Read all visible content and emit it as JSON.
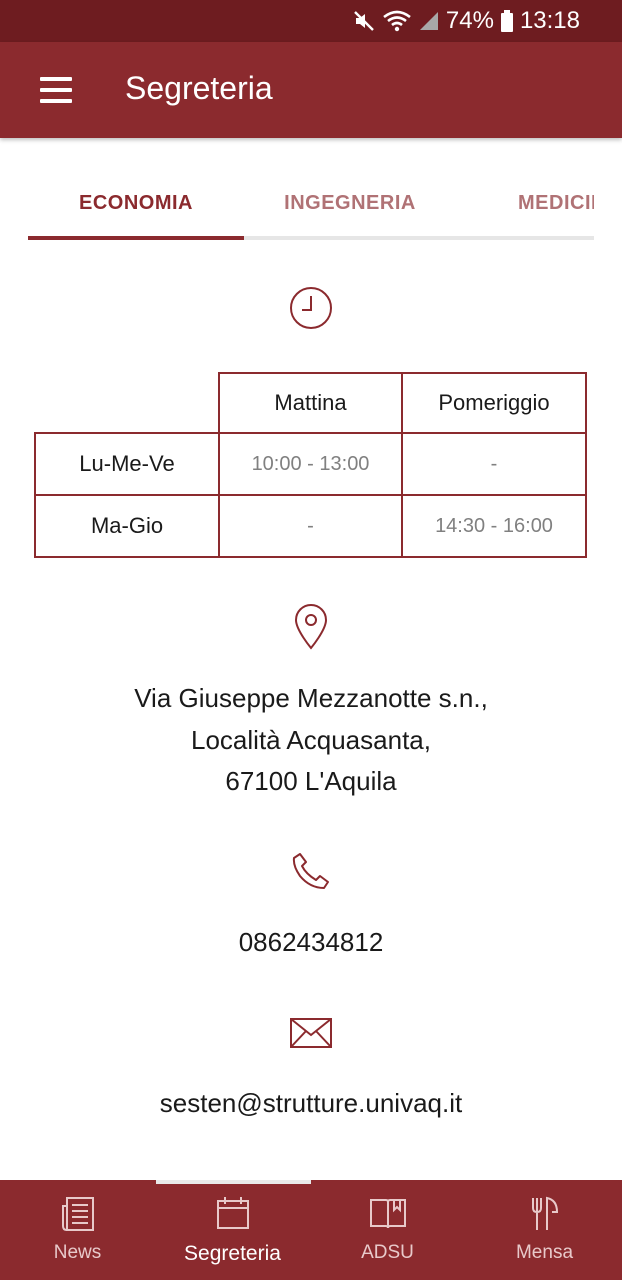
{
  "status_bar": {
    "battery": "74%",
    "time": "13:18"
  },
  "app_bar": {
    "title": "Segreteria"
  },
  "tabs": [
    {
      "label": "ECONOMIA",
      "active": true
    },
    {
      "label": "INGEGNERIA",
      "active": false
    },
    {
      "label": "MEDICIN",
      "active": false
    }
  ],
  "schedule": {
    "columns": [
      "Mattina",
      "Pomeriggio"
    ],
    "rows": [
      {
        "day": "Lu-Me-Ve",
        "morning": "10:00 - 13:00",
        "afternoon": "-"
      },
      {
        "day": "Ma-Gio",
        "morning": "-",
        "afternoon": "14:30 - 16:00"
      }
    ]
  },
  "address": {
    "line1": "Via Giuseppe Mezzanotte s.n.,",
    "line2": "Località Acquasanta,",
    "line3": "67100 L'Aquila"
  },
  "phone": "0862434812",
  "email": "sesten@strutture.univaq.it",
  "bottom_nav": [
    {
      "label": "News",
      "icon": "newspaper-icon",
      "active": false
    },
    {
      "label": "Segreteria",
      "icon": "calendar-icon",
      "active": true
    },
    {
      "label": "ADSU",
      "icon": "book-icon",
      "active": false
    },
    {
      "label": "Mensa",
      "icon": "cutlery-icon",
      "active": false
    }
  ],
  "colors": {
    "primary": "#8b2a2e",
    "status_bar": "#6e1c20",
    "tab_inactive": "#b07275"
  }
}
